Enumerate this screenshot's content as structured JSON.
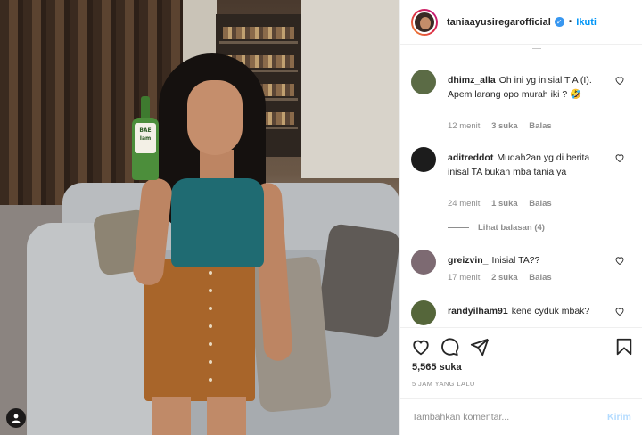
{
  "post": {
    "bottle_label": "BAE\nIam"
  },
  "header": {
    "username": "taniaayusiregarofficial",
    "separator": "•",
    "follow_label": "Ikuti"
  },
  "comments": [
    {
      "user": "dhimz_alla",
      "text": "Oh ini yg inisial T A (I). Apem larang opo murah iki ? 🤣",
      "time": "12 menit",
      "likes": "3 suka",
      "reply": "Balas",
      "avatar_color": "#5b6b45"
    },
    {
      "user": "aditreddot",
      "text": "Mudah2an yg di berita inisal TA bukan mba tania ya",
      "time": "24 menit",
      "likes": "1 suka",
      "reply": "Balas",
      "avatar_color": "#1c1c1c"
    },
    {
      "user": "greizvin_",
      "text": "Inisial TA??",
      "time": "17 menit",
      "likes": "2 suka",
      "reply": "Balas",
      "avatar_color": "#7d6a72"
    },
    {
      "user": "randyilham91",
      "text": "kene cyduk mbak?",
      "avatar_color": "#55663a"
    }
  ],
  "view_replies": "Lihat balasan (4)",
  "likes_count": "5,565 suka",
  "posted_time": "5 JAM YANG LALU",
  "add_comment": {
    "placeholder": "Tambahkan komentar...",
    "send_label": "Kirim"
  },
  "colors": {
    "accent": "#0095f6",
    "muted": "#8e8e8e",
    "text": "#262626"
  },
  "icons": [
    "user-tag-icon",
    "heart-icon",
    "comment-icon",
    "share-icon",
    "bookmark-icon",
    "verified-icon"
  ]
}
